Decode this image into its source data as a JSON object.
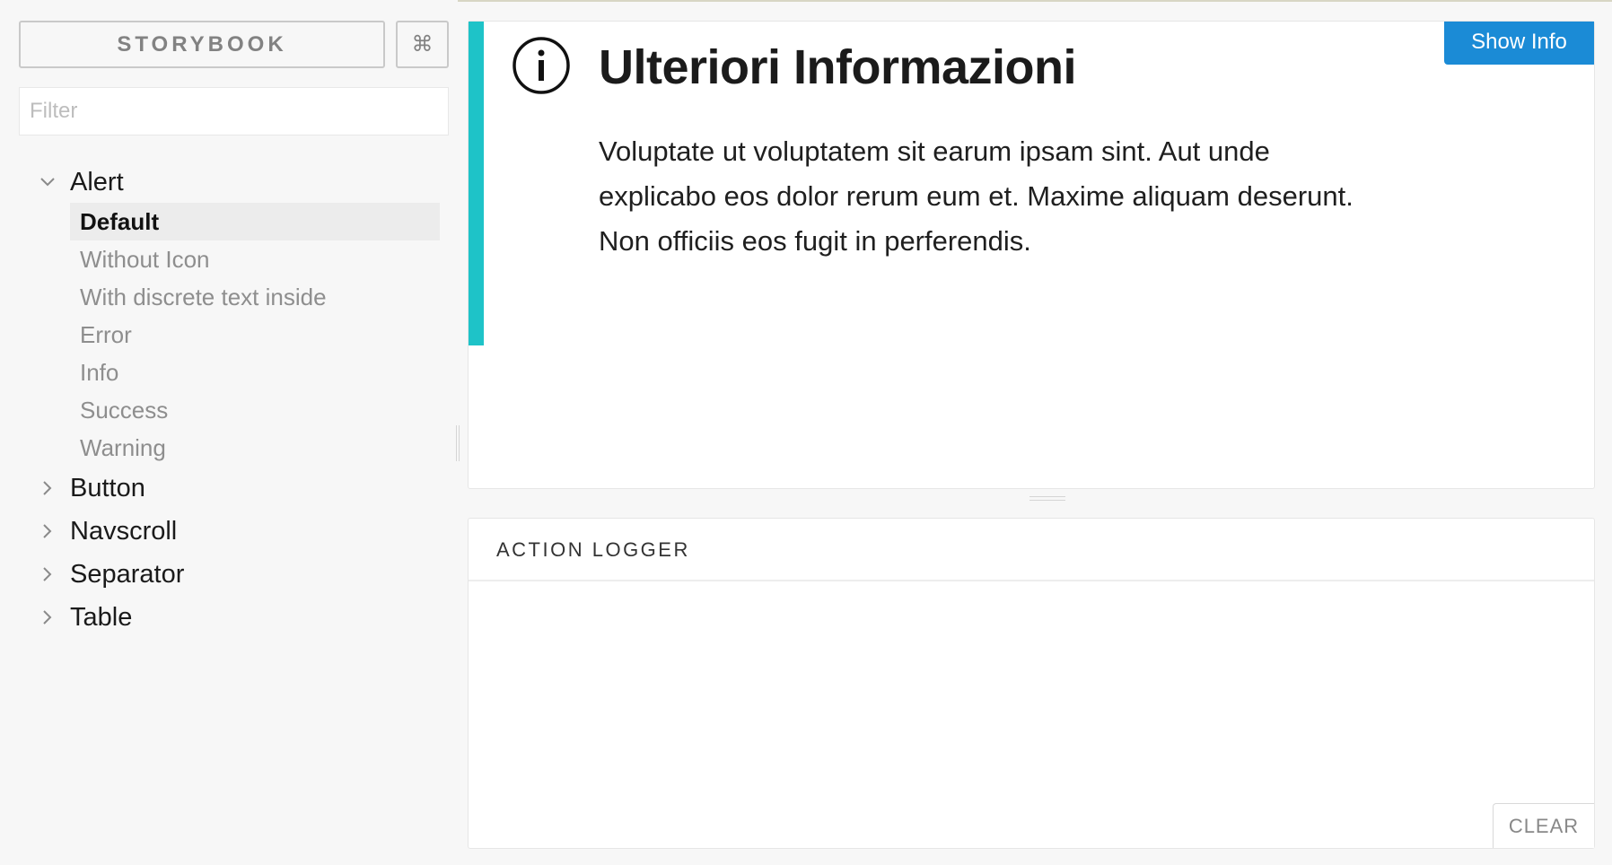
{
  "sidebar": {
    "brand_label": "STORYBOOK",
    "shortcut_label": "⌘",
    "filter_placeholder": "Filter",
    "groups": [
      {
        "label": "Alert",
        "expanded": true,
        "stories": [
          {
            "label": "Default",
            "active": true
          },
          {
            "label": "Without Icon"
          },
          {
            "label": "With discrete text inside"
          },
          {
            "label": "Error"
          },
          {
            "label": "Info"
          },
          {
            "label": "Success"
          },
          {
            "label": "Warning"
          }
        ]
      },
      {
        "label": "Button",
        "expanded": false
      },
      {
        "label": "Navscroll",
        "expanded": false
      },
      {
        "label": "Separator",
        "expanded": false
      },
      {
        "label": "Table",
        "expanded": false
      }
    ]
  },
  "preview": {
    "show_info_label": "Show Info",
    "alert": {
      "icon": "info-circle-icon",
      "title": "Ulteriori Informazioni",
      "body": "Voluptate ut voluptatem sit earum ipsam sint. Aut unde explicabo eos dolor rerum eum et. Maxime aliquam deserunt. Non officiis eos fugit in perferendis.",
      "accent_color": "#1ec3c8"
    },
    "button_color": "#1b8bd6"
  },
  "action_logger": {
    "tab_label": "ACTION LOGGER",
    "clear_label": "CLEAR"
  }
}
